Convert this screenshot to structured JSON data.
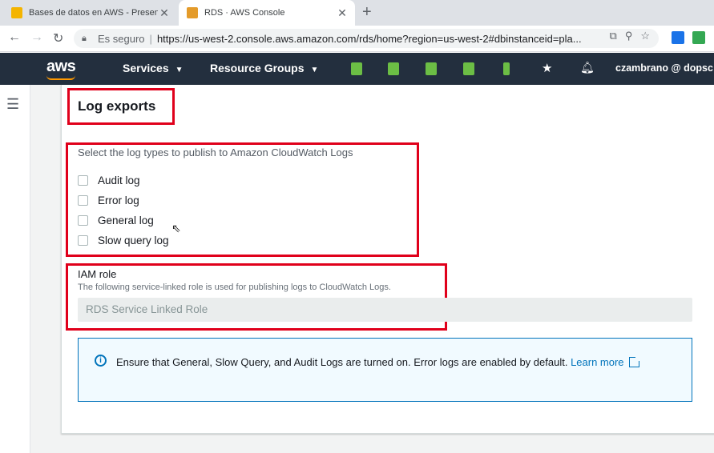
{
  "browser": {
    "tabs": [
      {
        "title": "Bases de datos en AWS - Presentació",
        "favicon_color": "#f4b400"
      },
      {
        "title": "RDS · AWS Console",
        "favicon_color": "#e49b2a"
      }
    ],
    "new_tab": "+",
    "address": {
      "secure_label": "Es seguro",
      "separator": "|",
      "url": "https://us-west-2.console.aws.amazon.com/rds/home?region=us-west-2#dbinstanceid=pla..."
    }
  },
  "aws_nav": {
    "logo": "aws",
    "services": "Services",
    "resource_groups": "Resource Groups",
    "user": "czambrano @ dopsc"
  },
  "section": {
    "title": "Log exports",
    "description": "Select the log types to publish to Amazon CloudWatch Logs",
    "log_types": [
      "Audit log",
      "Error log",
      "General log",
      "Slow query log"
    ],
    "iam": {
      "label": "IAM role",
      "description": "The following service-linked role is used for publishing logs to CloudWatch Logs.",
      "value": "RDS Service Linked Role"
    },
    "info": {
      "text": "Ensure that General, Slow Query, and Audit Logs are turned on. Error logs are enabled by default.",
      "link": "Learn more"
    }
  },
  "colors": {
    "aws_nav": "#232f3e",
    "highlight": "#e0001b",
    "link": "#0073bb"
  }
}
